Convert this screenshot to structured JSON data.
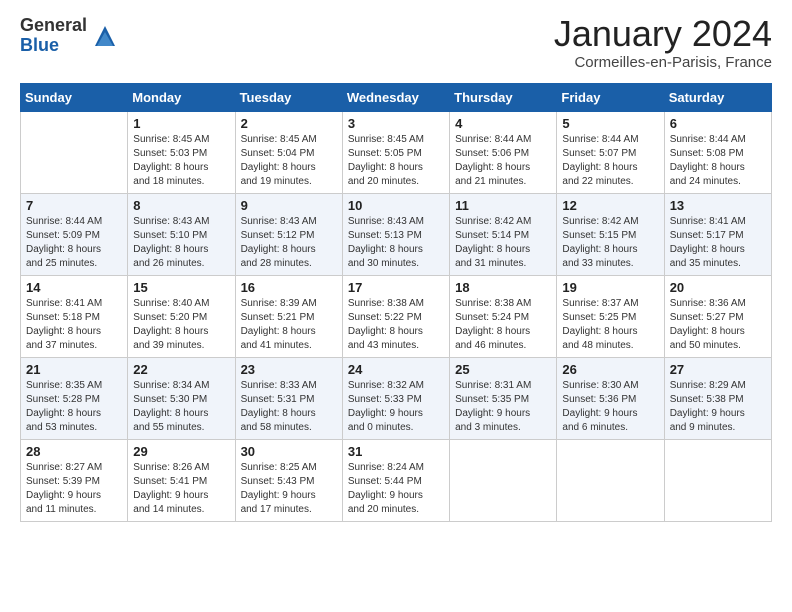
{
  "header": {
    "logo_general": "General",
    "logo_blue": "Blue",
    "title": "January 2024",
    "location": "Cormeilles-en-Parisis, France"
  },
  "days_of_week": [
    "Sunday",
    "Monday",
    "Tuesday",
    "Wednesday",
    "Thursday",
    "Friday",
    "Saturday"
  ],
  "weeks": [
    [
      {
        "num": "",
        "info": ""
      },
      {
        "num": "1",
        "info": "Sunrise: 8:45 AM\nSunset: 5:03 PM\nDaylight: 8 hours\nand 18 minutes."
      },
      {
        "num": "2",
        "info": "Sunrise: 8:45 AM\nSunset: 5:04 PM\nDaylight: 8 hours\nand 19 minutes."
      },
      {
        "num": "3",
        "info": "Sunrise: 8:45 AM\nSunset: 5:05 PM\nDaylight: 8 hours\nand 20 minutes."
      },
      {
        "num": "4",
        "info": "Sunrise: 8:44 AM\nSunset: 5:06 PM\nDaylight: 8 hours\nand 21 minutes."
      },
      {
        "num": "5",
        "info": "Sunrise: 8:44 AM\nSunset: 5:07 PM\nDaylight: 8 hours\nand 22 minutes."
      },
      {
        "num": "6",
        "info": "Sunrise: 8:44 AM\nSunset: 5:08 PM\nDaylight: 8 hours\nand 24 minutes."
      }
    ],
    [
      {
        "num": "7",
        "info": "Sunrise: 8:44 AM\nSunset: 5:09 PM\nDaylight: 8 hours\nand 25 minutes."
      },
      {
        "num": "8",
        "info": "Sunrise: 8:43 AM\nSunset: 5:10 PM\nDaylight: 8 hours\nand 26 minutes."
      },
      {
        "num": "9",
        "info": "Sunrise: 8:43 AM\nSunset: 5:12 PM\nDaylight: 8 hours\nand 28 minutes."
      },
      {
        "num": "10",
        "info": "Sunrise: 8:43 AM\nSunset: 5:13 PM\nDaylight: 8 hours\nand 30 minutes."
      },
      {
        "num": "11",
        "info": "Sunrise: 8:42 AM\nSunset: 5:14 PM\nDaylight: 8 hours\nand 31 minutes."
      },
      {
        "num": "12",
        "info": "Sunrise: 8:42 AM\nSunset: 5:15 PM\nDaylight: 8 hours\nand 33 minutes."
      },
      {
        "num": "13",
        "info": "Sunrise: 8:41 AM\nSunset: 5:17 PM\nDaylight: 8 hours\nand 35 minutes."
      }
    ],
    [
      {
        "num": "14",
        "info": "Sunrise: 8:41 AM\nSunset: 5:18 PM\nDaylight: 8 hours\nand 37 minutes."
      },
      {
        "num": "15",
        "info": "Sunrise: 8:40 AM\nSunset: 5:20 PM\nDaylight: 8 hours\nand 39 minutes."
      },
      {
        "num": "16",
        "info": "Sunrise: 8:39 AM\nSunset: 5:21 PM\nDaylight: 8 hours\nand 41 minutes."
      },
      {
        "num": "17",
        "info": "Sunrise: 8:38 AM\nSunset: 5:22 PM\nDaylight: 8 hours\nand 43 minutes."
      },
      {
        "num": "18",
        "info": "Sunrise: 8:38 AM\nSunset: 5:24 PM\nDaylight: 8 hours\nand 46 minutes."
      },
      {
        "num": "19",
        "info": "Sunrise: 8:37 AM\nSunset: 5:25 PM\nDaylight: 8 hours\nand 48 minutes."
      },
      {
        "num": "20",
        "info": "Sunrise: 8:36 AM\nSunset: 5:27 PM\nDaylight: 8 hours\nand 50 minutes."
      }
    ],
    [
      {
        "num": "21",
        "info": "Sunrise: 8:35 AM\nSunset: 5:28 PM\nDaylight: 8 hours\nand 53 minutes."
      },
      {
        "num": "22",
        "info": "Sunrise: 8:34 AM\nSunset: 5:30 PM\nDaylight: 8 hours\nand 55 minutes."
      },
      {
        "num": "23",
        "info": "Sunrise: 8:33 AM\nSunset: 5:31 PM\nDaylight: 8 hours\nand 58 minutes."
      },
      {
        "num": "24",
        "info": "Sunrise: 8:32 AM\nSunset: 5:33 PM\nDaylight: 9 hours\nand 0 minutes."
      },
      {
        "num": "25",
        "info": "Sunrise: 8:31 AM\nSunset: 5:35 PM\nDaylight: 9 hours\nand 3 minutes."
      },
      {
        "num": "26",
        "info": "Sunrise: 8:30 AM\nSunset: 5:36 PM\nDaylight: 9 hours\nand 6 minutes."
      },
      {
        "num": "27",
        "info": "Sunrise: 8:29 AM\nSunset: 5:38 PM\nDaylight: 9 hours\nand 9 minutes."
      }
    ],
    [
      {
        "num": "28",
        "info": "Sunrise: 8:27 AM\nSunset: 5:39 PM\nDaylight: 9 hours\nand 11 minutes."
      },
      {
        "num": "29",
        "info": "Sunrise: 8:26 AM\nSunset: 5:41 PM\nDaylight: 9 hours\nand 14 minutes."
      },
      {
        "num": "30",
        "info": "Sunrise: 8:25 AM\nSunset: 5:43 PM\nDaylight: 9 hours\nand 17 minutes."
      },
      {
        "num": "31",
        "info": "Sunrise: 8:24 AM\nSunset: 5:44 PM\nDaylight: 9 hours\nand 20 minutes."
      },
      {
        "num": "",
        "info": ""
      },
      {
        "num": "",
        "info": ""
      },
      {
        "num": "",
        "info": ""
      }
    ]
  ]
}
